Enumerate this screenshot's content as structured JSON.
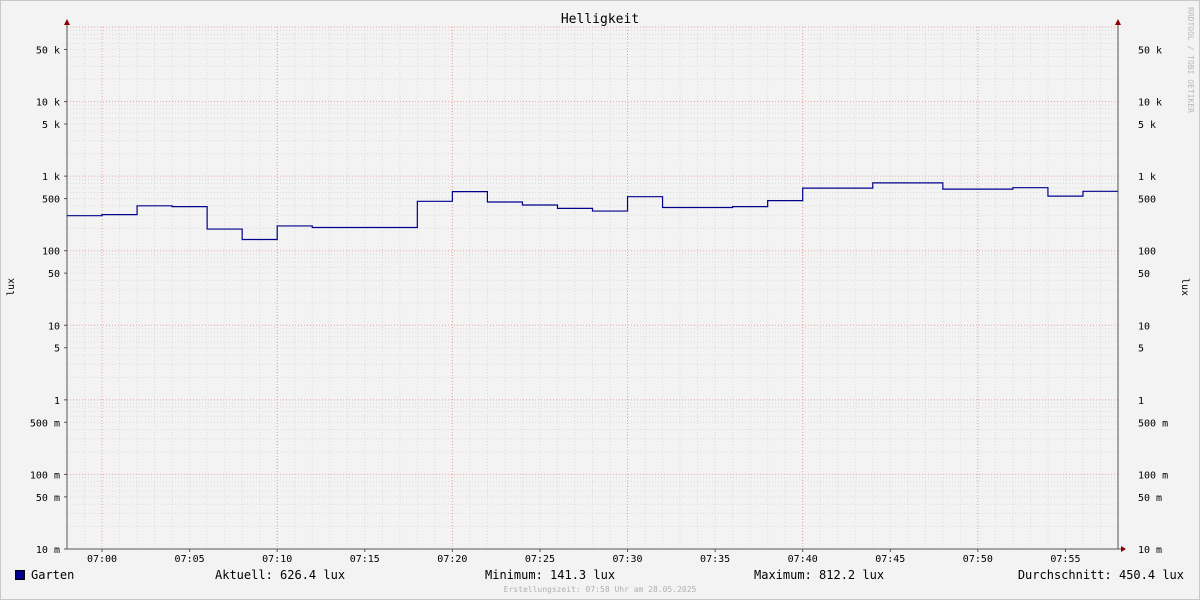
{
  "chart_data": {
    "type": "line",
    "title": "Helligkeit",
    "ylabel": "lux",
    "y_scale": "log",
    "ylim": [
      0.01,
      100000
    ],
    "xlim": [
      "06:58",
      "07:58"
    ],
    "x_ticks": [
      "07:00",
      "07:05",
      "07:10",
      "07:15",
      "07:20",
      "07:25",
      "07:30",
      "07:35",
      "07:40",
      "07:45",
      "07:50",
      "07:55"
    ],
    "y_ticks": [
      {
        "value": 50000,
        "label": "50 k"
      },
      {
        "value": 10000,
        "label": "10 k"
      },
      {
        "value": 5000,
        "label": "5 k"
      },
      {
        "value": 1000,
        "label": "1 k"
      },
      {
        "value": 500,
        "label": "500"
      },
      {
        "value": 100,
        "label": "100"
      },
      {
        "value": 50,
        "label": "50"
      },
      {
        "value": 10,
        "label": "10"
      },
      {
        "value": 5,
        "label": "5"
      },
      {
        "value": 1,
        "label": "1"
      },
      {
        "value": 0.5,
        "label": "500 m"
      },
      {
        "value": 0.1,
        "label": "100 m"
      },
      {
        "value": 0.05,
        "label": "50 m"
      },
      {
        "value": 0.01,
        "label": "10 m"
      }
    ],
    "series": [
      {
        "name": "Garten",
        "color": "#00008b",
        "step": true,
        "x": [
          "06:58",
          "07:00",
          "07:02",
          "07:04",
          "07:06",
          "07:08",
          "07:10",
          "07:12",
          "07:14",
          "07:16",
          "07:18",
          "07:20",
          "07:22",
          "07:24",
          "07:26",
          "07:28",
          "07:30",
          "07:32",
          "07:34",
          "07:36",
          "07:38",
          "07:40",
          "07:42",
          "07:44",
          "07:46",
          "07:48",
          "07:50",
          "07:52",
          "07:54",
          "07:56"
        ],
        "values": [
          295,
          305,
          400,
          390,
          195,
          141.3,
          215,
          205,
          205,
          205,
          460,
          620,
          450,
          410,
          370,
          340,
          530,
          380,
          380,
          390,
          470,
          690,
          690,
          812.2,
          812.2,
          670,
          670,
          700,
          540,
          626.4
        ]
      }
    ],
    "grid": true,
    "legend_position": "bottom-left"
  },
  "legend": {
    "series_name": "Garten",
    "current": "Aktuell: 626.4 lux",
    "minimum": "Minimum: 141.3 lux",
    "maximum": "Maximum: 812.2 lux",
    "average": "Durchschnitt: 450.4 lux"
  },
  "footer": "Erstellungszeit: 07:58 Uhr am 28.05.2025",
  "watermark": "RRDTOOL / TOBI OETIKER"
}
